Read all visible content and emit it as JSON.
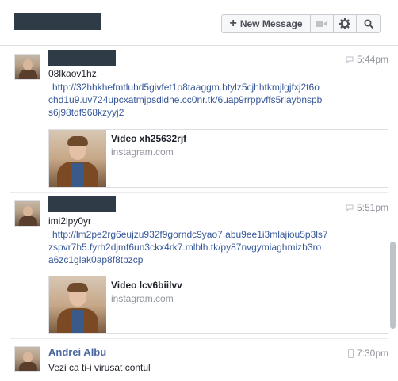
{
  "header": {
    "new_message_label": "New Message",
    "icons": [
      "plus-icon",
      "video-icon",
      "gear-icon",
      "search-icon"
    ]
  },
  "messages": [
    {
      "time": "5:44pm",
      "text": "08lkaov1hz",
      "link_lines": [
        "http://32hhkhefmtluhd5givfet1o8taaggm.btylz5cjhhtkmjlgjfxj2t6o",
        "chd1u9.uv724upcxatmjpsdldne.cc0nr.tk/6uap9rrppvffs5rlaybnspb",
        "s6j98tdf968kzyyj2"
      ],
      "attachment": {
        "title": "Video xh25632rjf",
        "source": "instagram.com"
      }
    },
    {
      "time": "5:51pm",
      "text": "imi2lpy0yr",
      "link_lines": [
        "http://lm2pe2rg6eujzu932f9gorndc9yao7.abu9ee1i3mlajiou5p3ls7",
        "zspvr7h5.fyrh2djmf6un3ckx4rk7.mlblh.tk/py87nvgymiaghmizb3ro",
        "a6zc1glak0ap8f8tpzcp"
      ],
      "attachment": {
        "title": "Video lcv6biilvv",
        "source": "instagram.com"
      }
    },
    {
      "sender": "Andrei Albu",
      "time": "7:30pm",
      "text": "Vezi ca ti-i virusat contul"
    }
  ],
  "colors": {
    "link": "#365899",
    "sender": "#4b67a1",
    "muted": "#90949c",
    "redaction": "#2f3c48"
  }
}
